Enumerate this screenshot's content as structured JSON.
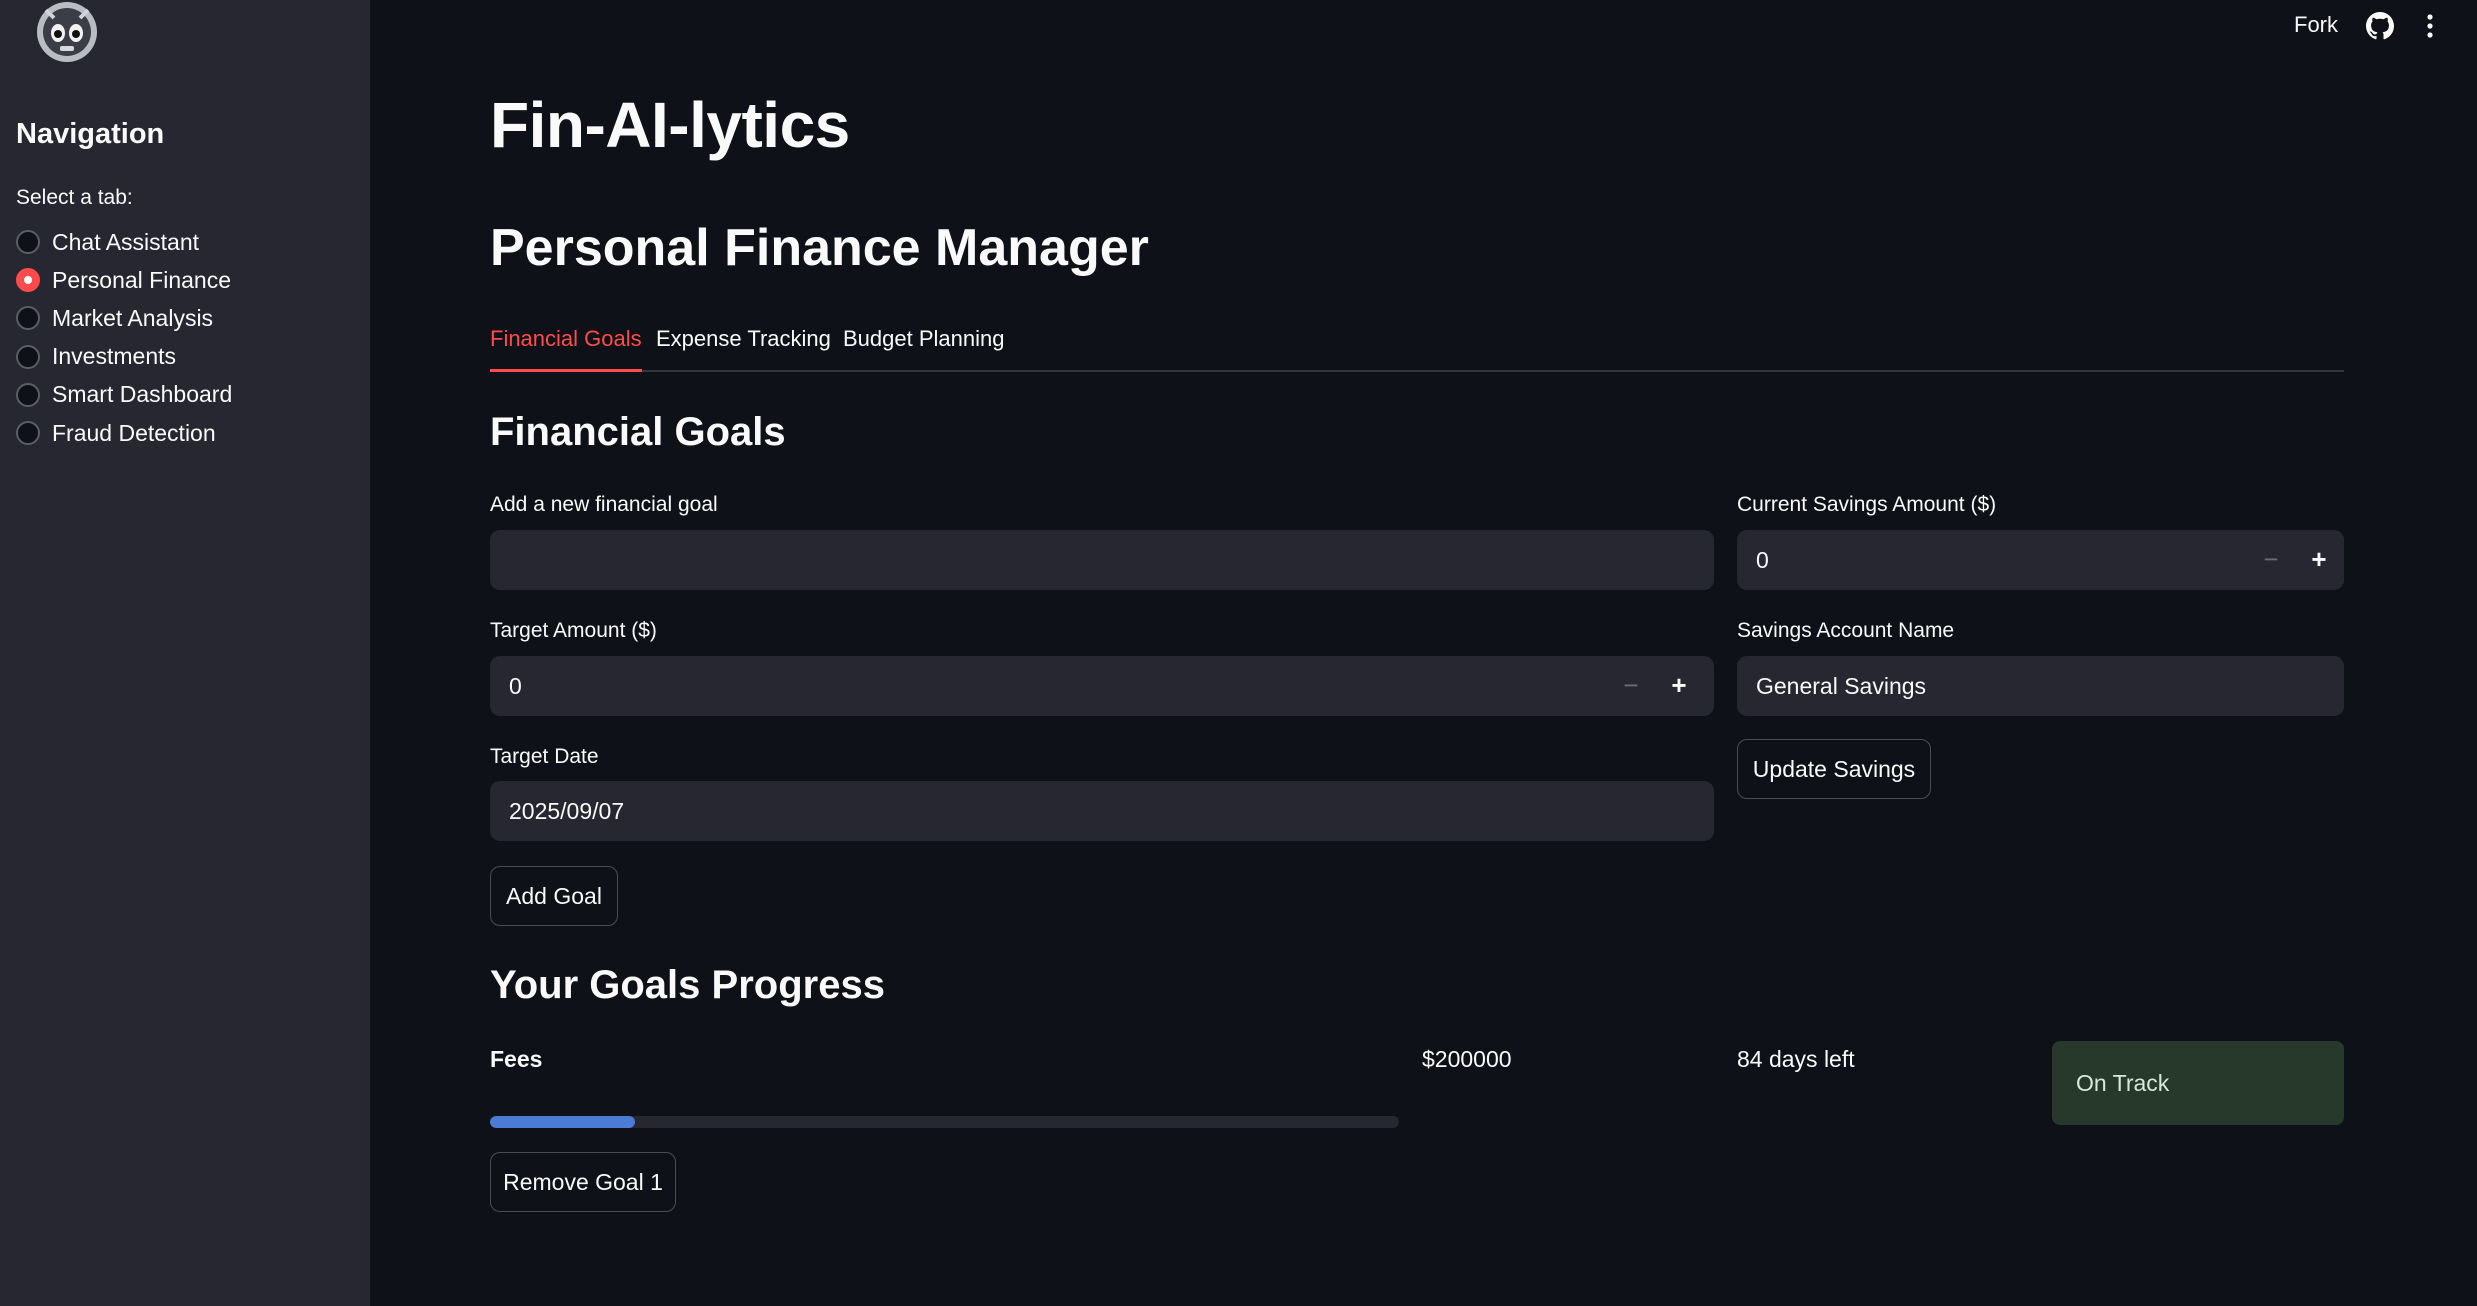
{
  "sidebar": {
    "title": "Navigation",
    "select_label": "Select a tab:",
    "items": [
      {
        "label": "Chat Assistant",
        "selected": false
      },
      {
        "label": "Personal Finance",
        "selected": true
      },
      {
        "label": "Market Analysis",
        "selected": false
      },
      {
        "label": "Investments",
        "selected": false
      },
      {
        "label": "Smart Dashboard",
        "selected": false
      },
      {
        "label": "Fraud Detection",
        "selected": false
      }
    ]
  },
  "header": {
    "fork_label": "Fork"
  },
  "main": {
    "app_title": "Fin-AI-lytics",
    "page_title": "Personal Finance Manager",
    "tabs": [
      {
        "label": "Financial Goals",
        "active": true
      },
      {
        "label": "Expense Tracking",
        "active": false
      },
      {
        "label": "Budget Planning",
        "active": false
      }
    ],
    "section_title": "Financial Goals",
    "form": {
      "goal_label": "Add a new financial goal",
      "goal_value": "",
      "target_label": "Target Amount ($)",
      "target_value": "0",
      "date_label": "Target Date",
      "date_value": "2025/09/07",
      "add_button": "Add Goal",
      "savings_label": "Current Savings Amount ($)",
      "savings_value": "0",
      "account_label": "Savings Account Name",
      "account_value": "General Savings",
      "update_button": "Update Savings",
      "minus_symbol": "−",
      "plus_symbol": "+"
    },
    "progress": {
      "title": "Your Goals Progress",
      "goals": [
        {
          "name": "Fees",
          "amount": "$200000",
          "days_left": "84 days left",
          "status": "On Track",
          "progress_fraction": 0.16,
          "remove_button": "Remove Goal 1"
        }
      ]
    }
  },
  "colors": {
    "accent": "#ff4b4b",
    "progress": "#4c7bd6",
    "status_bg": "#27392b",
    "background": "#0e1117",
    "sidebar_bg": "#262730"
  }
}
